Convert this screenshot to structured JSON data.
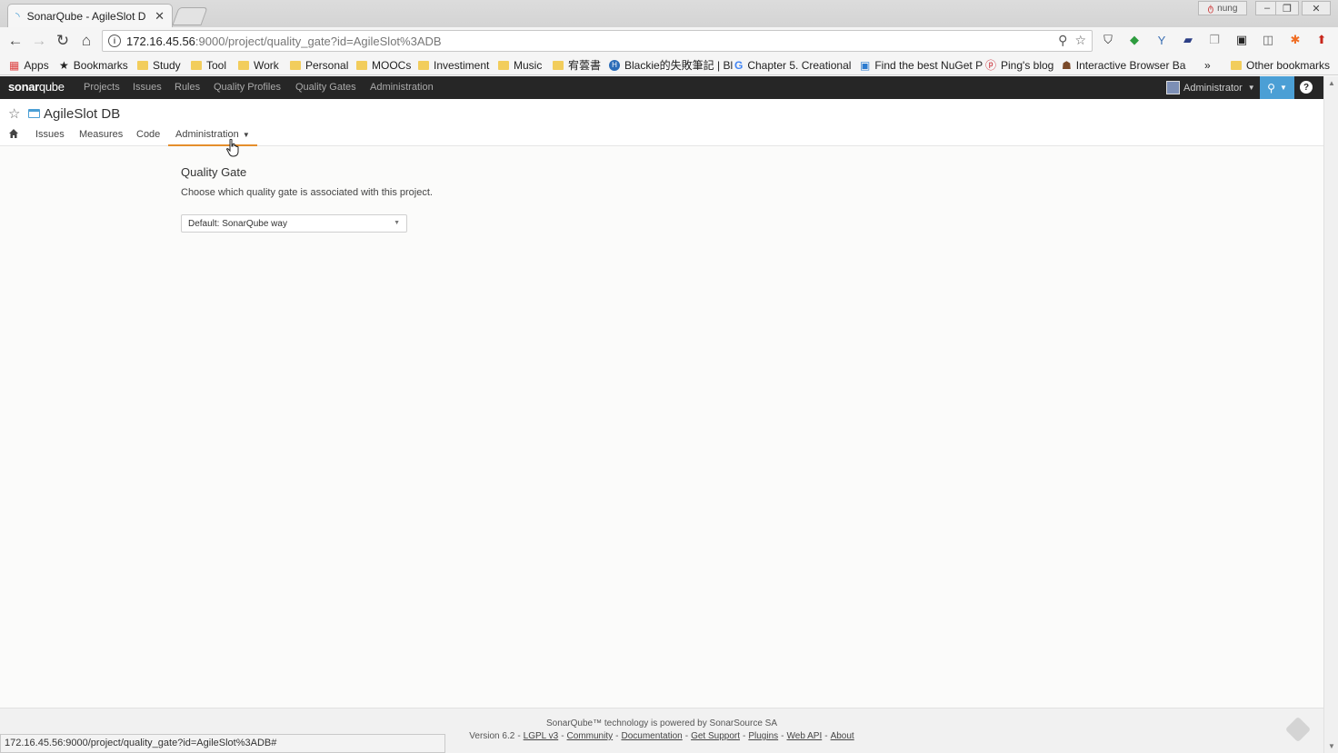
{
  "browser": {
    "tab_title": "SonarQube - AgileSlot D",
    "user_badge": "nung",
    "url_host": "172.16.45.56",
    "url_path": ":9000/project/quality_gate?id=AgileSlot%3ADB",
    "status_url": "172.16.45.56:9000/project/quality_gate?id=AgileSlot%3ADB#"
  },
  "bookmarks": {
    "items": [
      "Apps",
      "Bookmarks",
      "Study",
      "Tool",
      "Work",
      "Personal",
      "MOOCs",
      "Investiment",
      "Music",
      "宥蕓書",
      "Blackie的失敗筆記 | Bl",
      "Chapter 5. Creational",
      "Find the best NuGet P",
      "Ping's blog",
      "Interactive Browser Ba"
    ],
    "more": "»",
    "other": "Other bookmarks"
  },
  "sonar_nav": {
    "logo_a": "sonar",
    "logo_b": "qube",
    "items": [
      "Projects",
      "Issues",
      "Rules",
      "Quality Profiles",
      "Quality Gates",
      "Administration"
    ],
    "user": "Administrator"
  },
  "project": {
    "name": "AgileSlot DB",
    "nav": [
      "Issues",
      "Measures",
      "Code",
      "Administration"
    ]
  },
  "quality_gate": {
    "title": "Quality Gate",
    "description": "Choose which quality gate is associated with this project.",
    "selected": "Default: SonarQube way"
  },
  "footer": {
    "line1": "SonarQube™ technology is powered by SonarSource SA",
    "version": "Version 6.2",
    "links": [
      "LGPL v3",
      "Community",
      "Documentation",
      "Get Support",
      "Plugins",
      "Web API",
      "About"
    ]
  }
}
